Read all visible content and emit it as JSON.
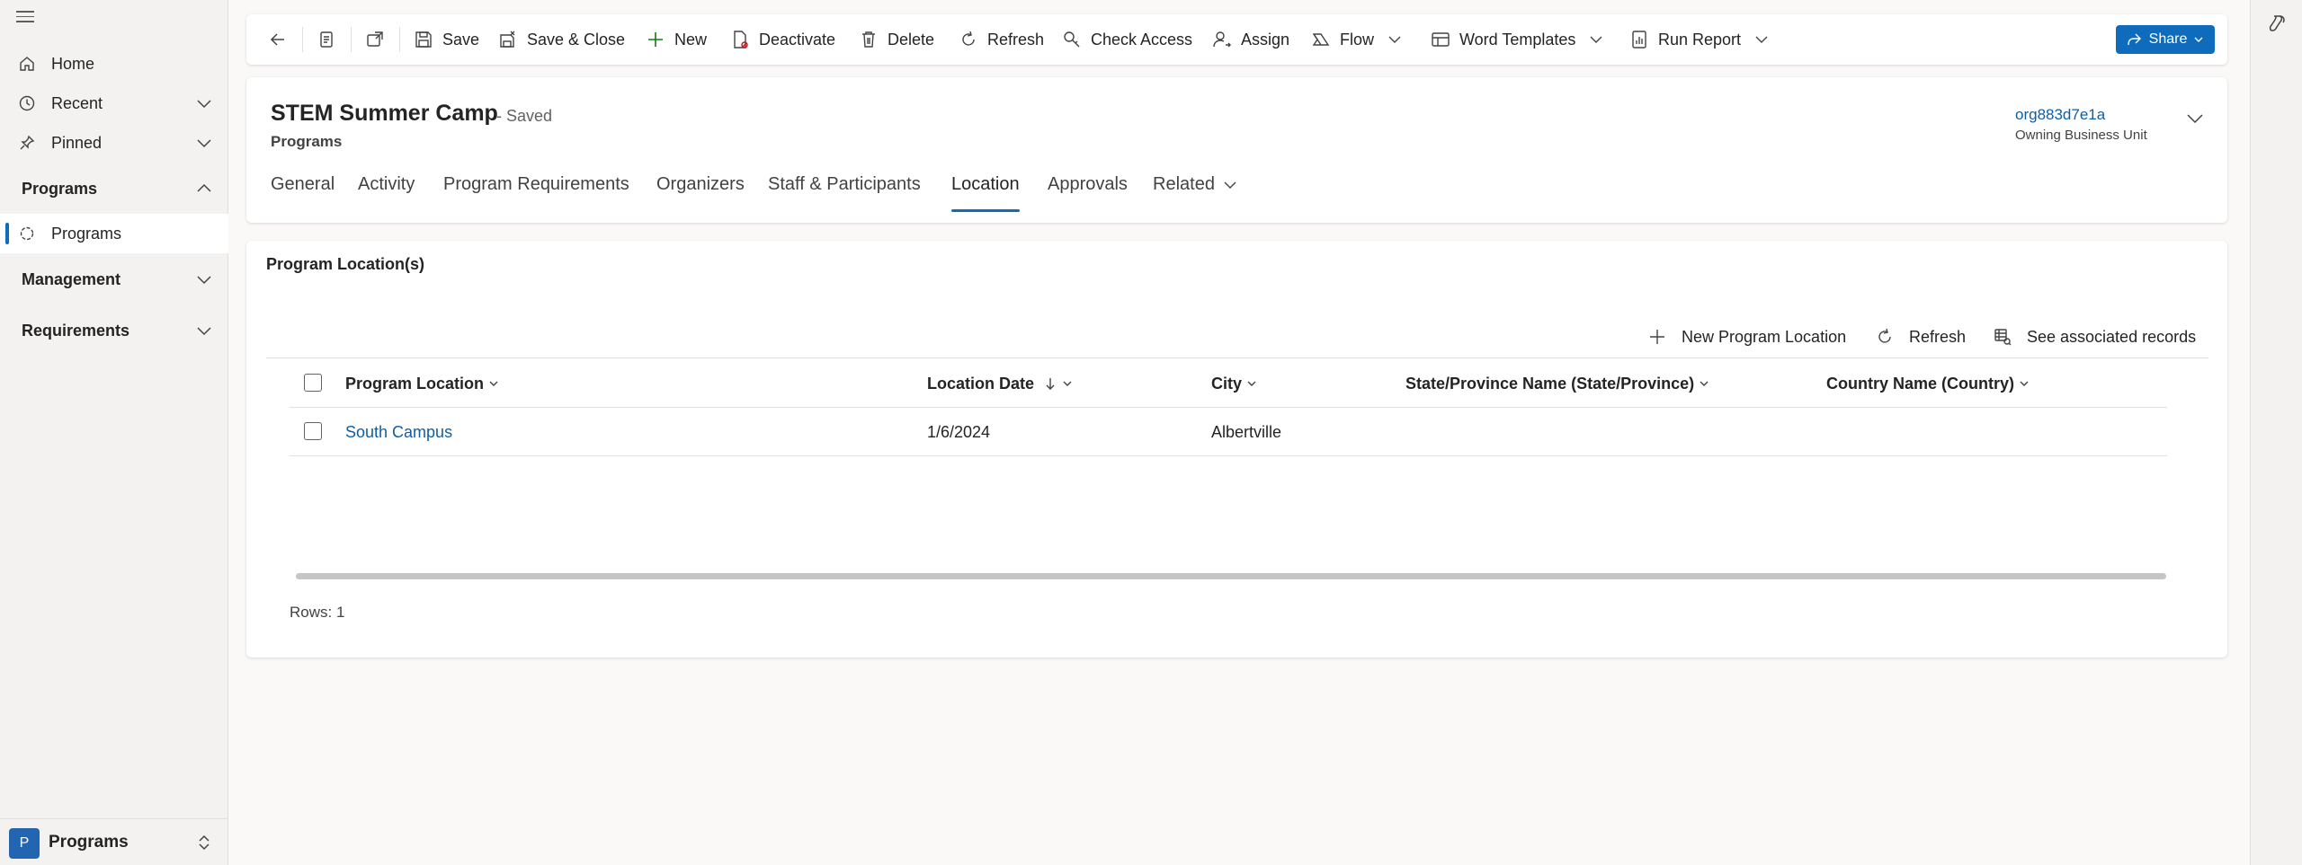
{
  "sidebar": {
    "items": [
      {
        "label": "Home",
        "icon": "home-icon"
      },
      {
        "label": "Recent",
        "icon": "clock-icon"
      },
      {
        "label": "Pinned",
        "icon": "pin-icon"
      }
    ],
    "groups": {
      "programs": {
        "label": "Programs",
        "items": [
          {
            "label": "Programs",
            "icon": "program-icon",
            "active": true
          }
        ]
      },
      "management": {
        "label": "Management"
      },
      "requirements": {
        "label": "Requirements"
      }
    },
    "area": {
      "badge": "P",
      "label": "Programs"
    }
  },
  "commandbar": {
    "save": "Save",
    "save_close": "Save & Close",
    "new": "New",
    "deactivate": "Deactivate",
    "delete": "Delete",
    "refresh": "Refresh",
    "check_access": "Check Access",
    "assign": "Assign",
    "flow": "Flow",
    "word_templates": "Word Templates",
    "run_report": "Run Report",
    "share": "Share"
  },
  "record": {
    "title": "STEM Summer Camp",
    "status": "- Saved",
    "entity": "Programs",
    "owner": "org883d7e1a",
    "owner_label": "Owning Business Unit"
  },
  "tabs": [
    "General",
    "Activity",
    "Program Requirements",
    "Organizers",
    "Staff & Participants",
    "Location",
    "Approvals",
    "Related"
  ],
  "active_tab": "Location",
  "subgrid": {
    "title": "Program Location(s)",
    "commands": {
      "new": "New Program Location",
      "refresh": "Refresh",
      "associated": "See associated records"
    },
    "columns": [
      "Program Location",
      "Location Date",
      "City",
      "State/Province Name (State/Province)",
      "Country Name (Country)"
    ],
    "rows": [
      {
        "program_location": "South Campus",
        "location_date": "1/6/2024",
        "city": "Albertville",
        "state": "",
        "country": ""
      }
    ],
    "rows_count": "Rows: 1"
  },
  "colors": {
    "accent": "#0f6cbd",
    "link": "#115ea3",
    "background": "#faf9f8"
  }
}
